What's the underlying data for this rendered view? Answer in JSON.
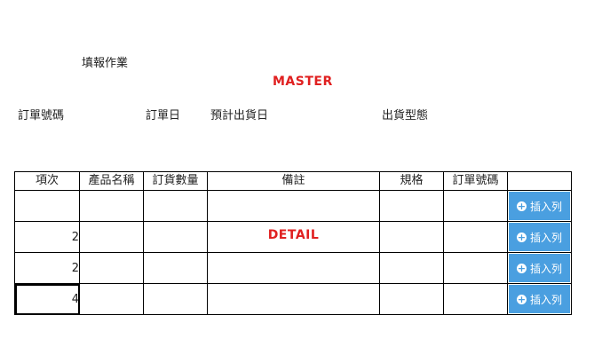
{
  "form": {
    "title": "填報作業",
    "master_label": "MASTER",
    "fields": [
      "訂單號碼",
      "訂單日",
      "預計出貨日",
      "出貨型態"
    ]
  },
  "detail": {
    "label": "DETAIL",
    "headers": [
      "項次",
      "產品名稱",
      "訂貨數量",
      "備註",
      "規格",
      "訂單號碼",
      ""
    ],
    "rows": [
      {
        "item_no": ""
      },
      {
        "item_no": "2"
      },
      {
        "item_no": "2"
      },
      {
        "item_no": "4"
      }
    ],
    "insert_button_label": "插入列"
  },
  "colors": {
    "accent_red": "#e02020",
    "button_blue": "#4a9fe0"
  }
}
